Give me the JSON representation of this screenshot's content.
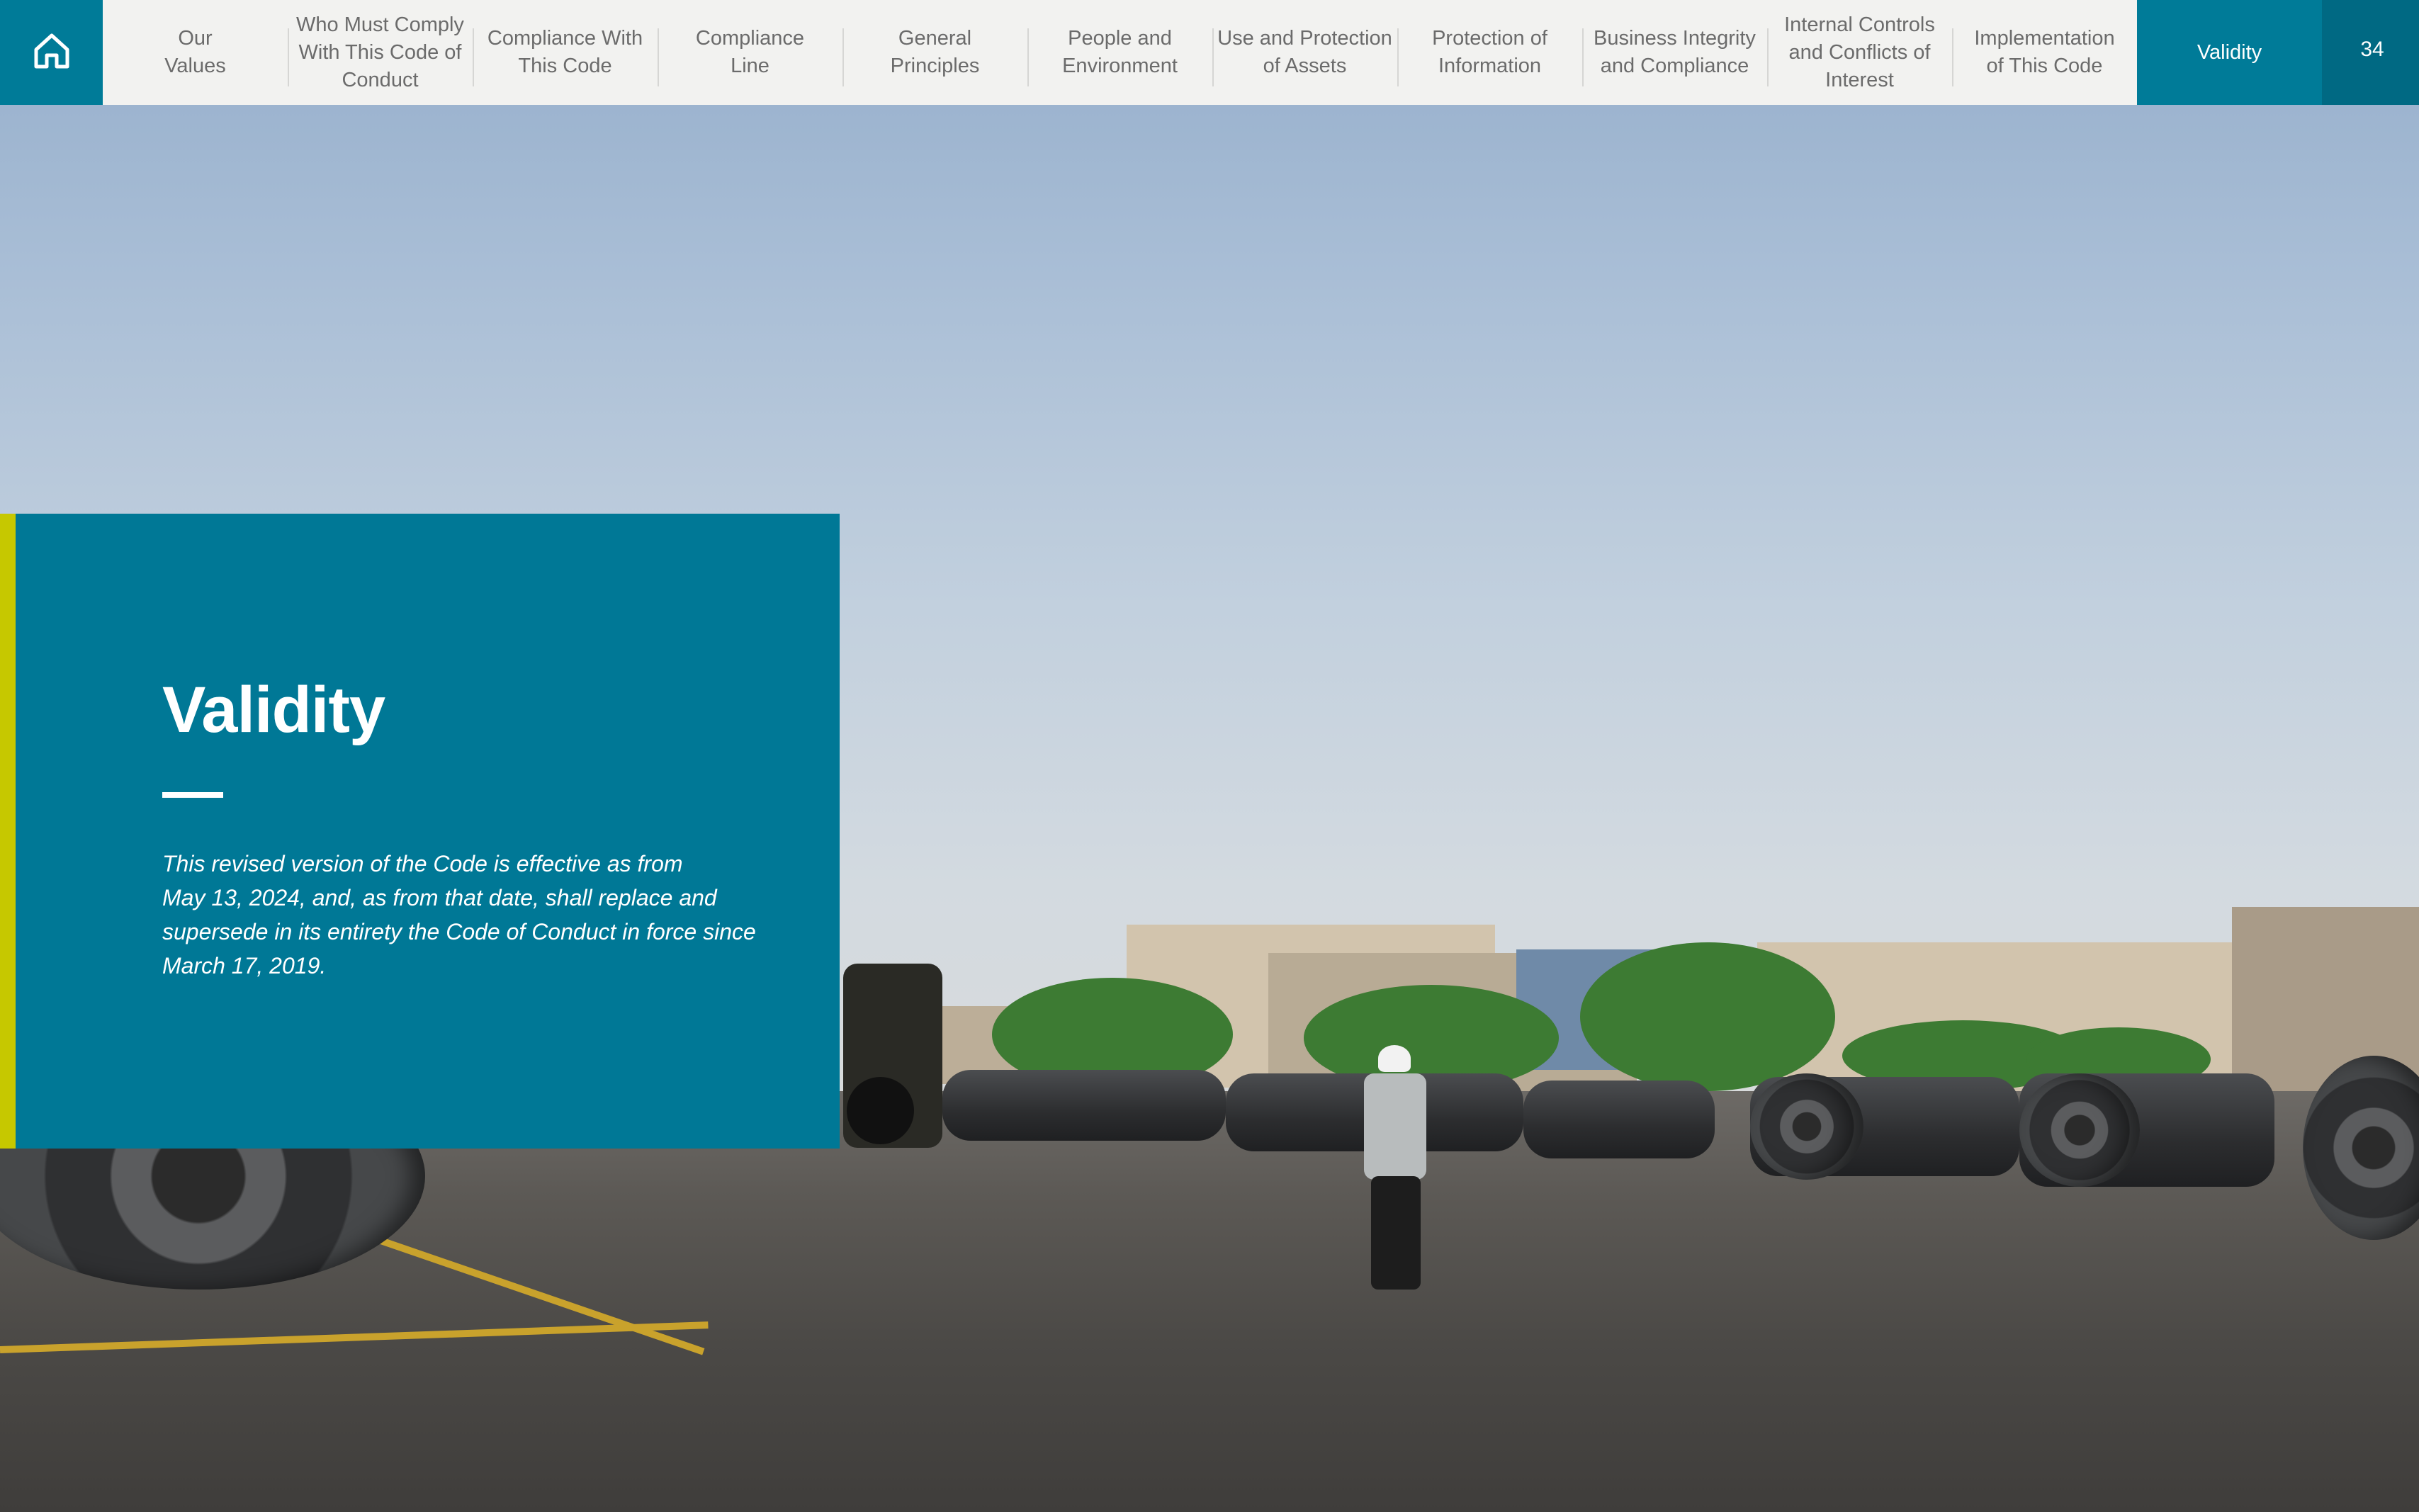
{
  "nav": {
    "home_label": "Home",
    "items": [
      {
        "label": "Our\nValues"
      },
      {
        "label": "Who Must Comply\nWith This Code of\nConduct"
      },
      {
        "label": "Compliance With\nThis Code"
      },
      {
        "label": "Compliance\nLine"
      },
      {
        "label": "General\nPrinciples"
      },
      {
        "label": "People and\nEnvironment"
      },
      {
        "label": "Use and Protection\nof Assets"
      },
      {
        "label": "Protection of\nInformation"
      },
      {
        "label": "Business Integrity\nand Compliance"
      },
      {
        "label": "Internal Controls\nand Conflicts of\nInterest"
      },
      {
        "label": "Implementation\nof This Code"
      },
      {
        "label": "Validity",
        "active": true
      }
    ],
    "page_number": "34"
  },
  "panel": {
    "title": "Validity",
    "body": "This revised version of the Code is effective as from\nMay 13, 2024, and, as from that date, shall replace and\nsupersede in its entirety the Code of Conduct in force since\nMarch 17, 2019."
  },
  "colors": {
    "accent_teal": "#007896",
    "accent_lime": "#c6c800",
    "nav_background": "#f2f2f0"
  }
}
